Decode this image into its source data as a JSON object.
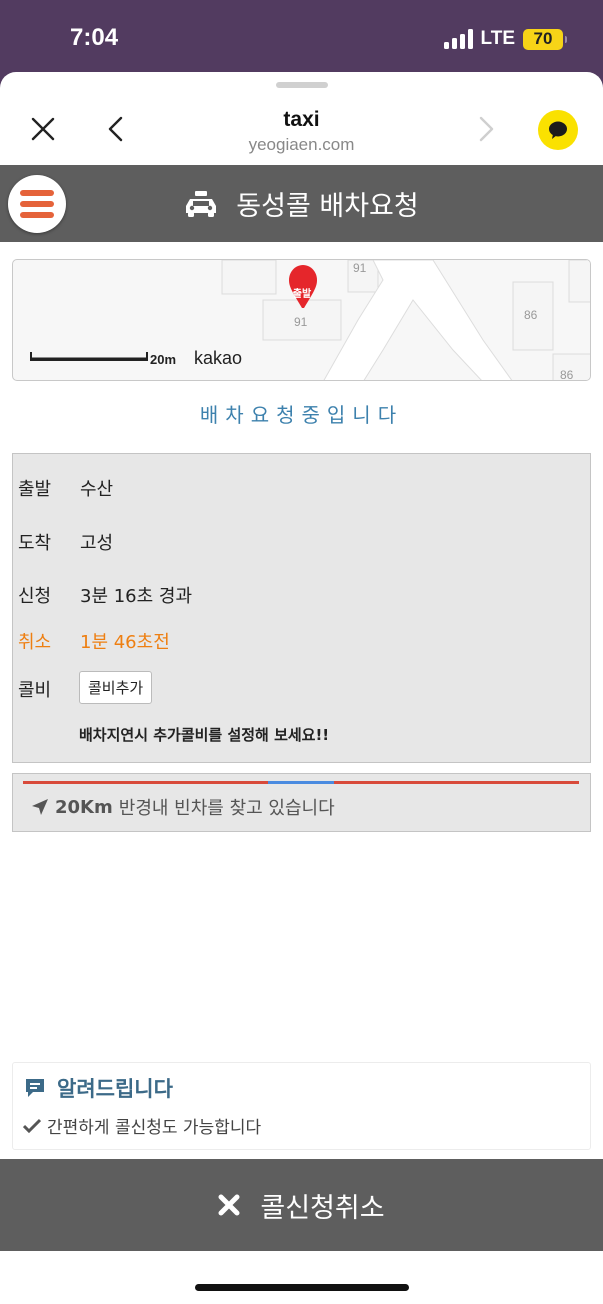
{
  "status_bar": {
    "time": "7:04",
    "network": "LTE",
    "battery": "70"
  },
  "browser": {
    "title": "taxi",
    "url": "yeogiaen.com"
  },
  "header": {
    "title": "동성콜 배차요청"
  },
  "map": {
    "scale_label": "20m",
    "logo": "kakao",
    "pin_label": "출발",
    "labels": [
      "91",
      "91",
      "86",
      "86"
    ]
  },
  "status_message": "배차요청중입니다",
  "trip": {
    "rows": [
      {
        "label": "출발",
        "value": "수산"
      },
      {
        "label": "도착",
        "value": "고성"
      },
      {
        "label": "신청",
        "value": "3분 16초 경과"
      },
      {
        "label": "취소",
        "value": "1분 46초전"
      }
    ],
    "tip": {
      "label": "콜비",
      "button": "콜비추가",
      "note": "배차지연시 추가콜비를 설정해 보세요!!"
    }
  },
  "search": {
    "distance": "20Km",
    "text": "반경내 빈차를 찾고 있습니다",
    "progress": 0.44
  },
  "notice": {
    "title": "알려드립니다",
    "text": "간편하게 콜신청도 가능합니다"
  },
  "cancel_button": {
    "label": "콜신청취소"
  },
  "colors": {
    "status_bar": "#523b60",
    "header": "#5e5e5e",
    "accent_orange": "#ee7f12",
    "accent_blue": "#3d81ad",
    "kakao_yellow": "#fae100"
  }
}
